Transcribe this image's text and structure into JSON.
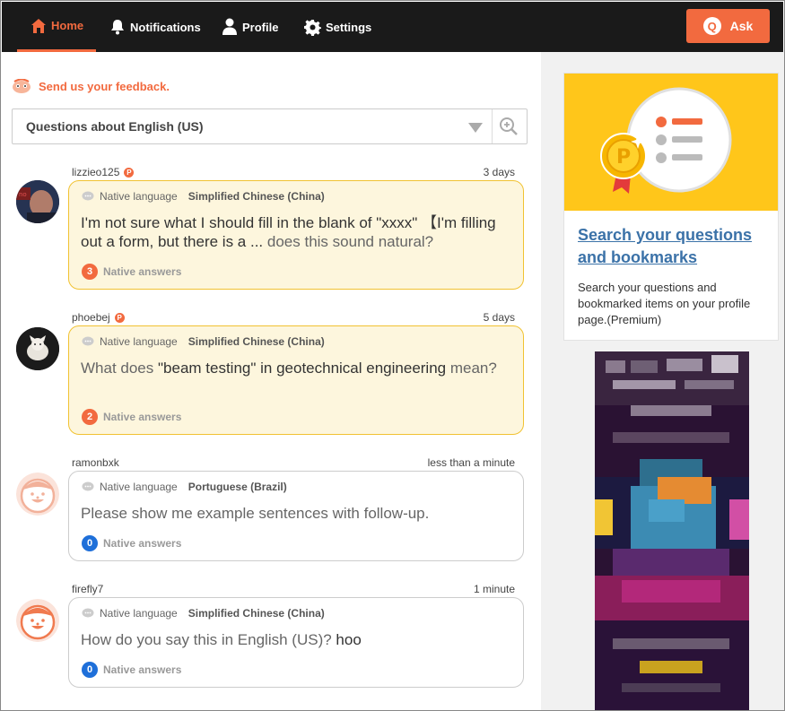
{
  "nav": {
    "home": "Home",
    "notifications": "Notifications",
    "profile": "Profile",
    "settings": "Settings",
    "ask": "Ask",
    "ask_icon_letter": "Q",
    "accent": "#f26a3f"
  },
  "feedback": "Send us your feedback.",
  "selector": {
    "value": "Questions about English (US)"
  },
  "questions": [
    {
      "user": "lizzieo125",
      "premium": true,
      "time": "3 days",
      "lang_label": "Native language",
      "lang": "Simplified Chinese (China)",
      "text": "I'm not sure what I should fill in the blank of \"xxxx\" 【I'm filling out a form, but there is a ...",
      "text_muted": "does this sound natural?",
      "answers_count": "3",
      "answers_label": "Native answers"
    },
    {
      "user": "phoebej",
      "premium": true,
      "time": "5 days",
      "lang_label": "Native language",
      "lang": "Simplified Chinese (China)",
      "text_muted_pre": "What does",
      "text": "\"beam testing\" in geotechnical engineering",
      "text_muted": "mean?",
      "answers_count": "2",
      "answers_label": "Native answers"
    },
    {
      "user": "ramonbxk",
      "premium": false,
      "time": "less than a minute",
      "lang_label": "Native language",
      "lang": "Portuguese (Brazil)",
      "text_muted": "Please show me example sentences with follow-up.",
      "answers_count": "0",
      "answers_label": "Native answers"
    },
    {
      "user": "firefly7",
      "premium": false,
      "time": "1 minute",
      "lang_label": "Native language",
      "lang": "Simplified Chinese (China)",
      "text_muted": "How do you say this in English (US)?",
      "text": "hoo",
      "answers_count": "0",
      "answers_label": "Native answers"
    }
  ],
  "sidebar": {
    "promo_link": "Search your questions and bookmarks",
    "promo_desc": "Search your questions and bookmarked items on your profile page.(Premium)",
    "promo_badge_letter": "P"
  }
}
